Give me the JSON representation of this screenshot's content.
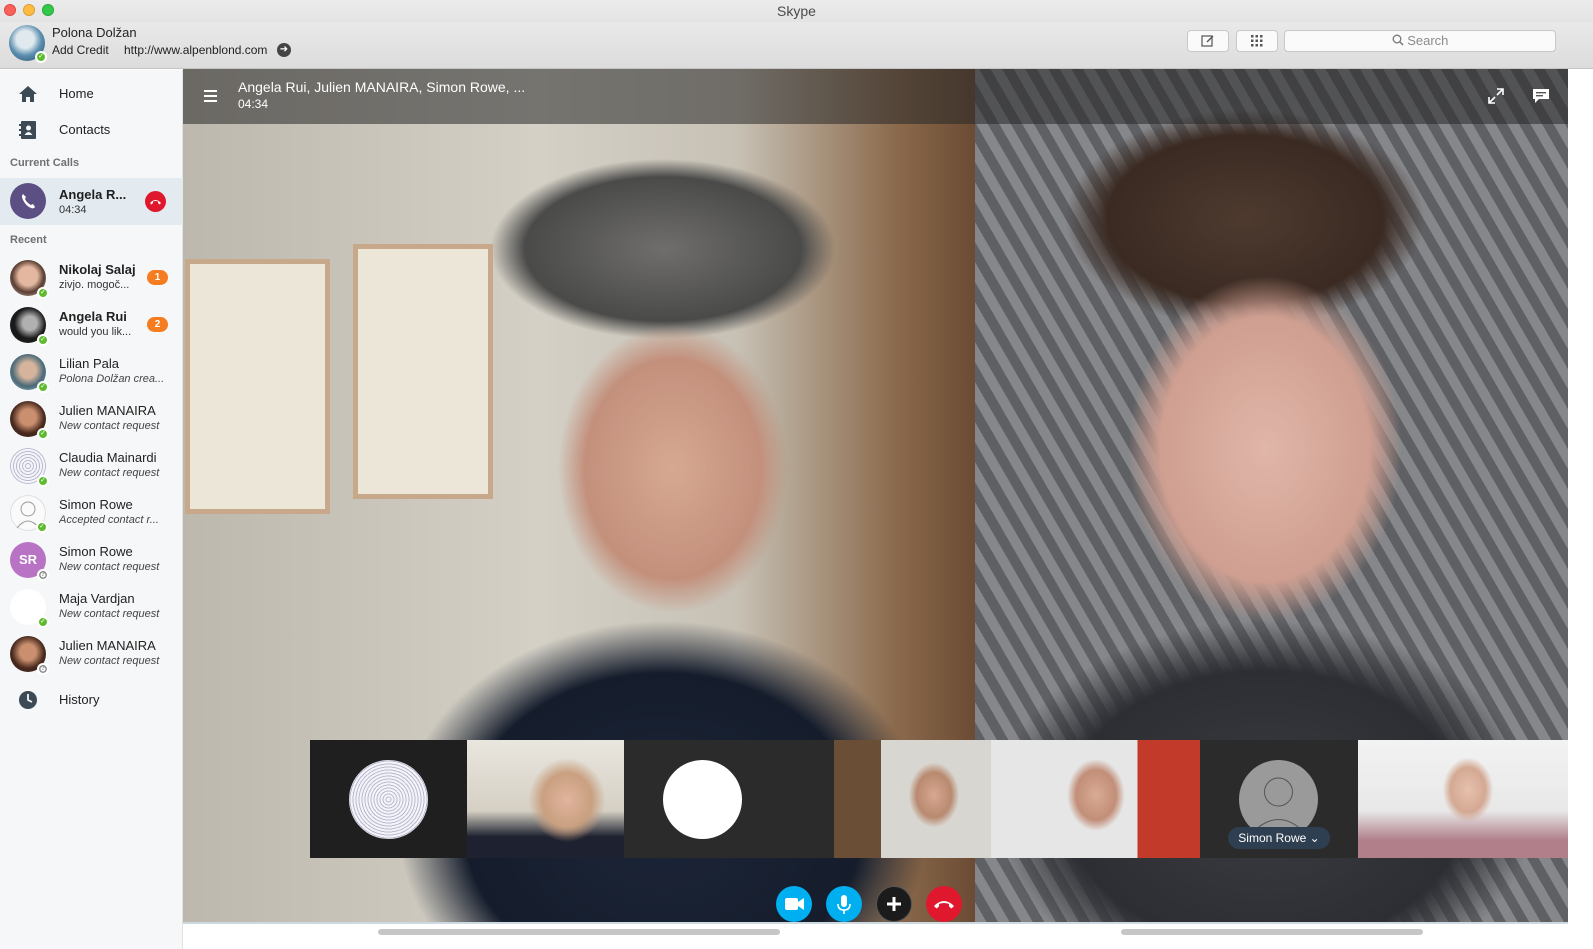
{
  "window": {
    "title": "Skype"
  },
  "profile": {
    "name": "Polona Dolžan",
    "add_credit": "Add Credit",
    "mood_link": "http://www.alpenblond.com"
  },
  "search": {
    "placeholder": "Search"
  },
  "sidebar": {
    "home_label": "Home",
    "contacts_label": "Contacts",
    "current_calls_title": "Current Calls",
    "current_call": {
      "name": "Angela R...",
      "duration": "04:34"
    },
    "recent_title": "Recent",
    "recent": [
      {
        "name": "Nikolaj Salaj",
        "status": "zivjo. mogoč...",
        "badge": "1",
        "bold": true
      },
      {
        "name": "Angela Rui",
        "status": "would you lik...",
        "badge": "2",
        "bold": true
      },
      {
        "name": "Lilian Pala",
        "status": "Polona Dolžan crea...",
        "badge": "",
        "bold": false
      },
      {
        "name": "Julien MANAIRA",
        "status": "New contact request",
        "badge": "",
        "bold": false
      },
      {
        "name": "Claudia Mainardi",
        "status": "New contact request",
        "badge": "",
        "bold": false
      },
      {
        "name": "Simon Rowe",
        "status": "Accepted contact r...",
        "badge": "",
        "bold": false
      },
      {
        "name": "Simon Rowe",
        "status": "New contact request",
        "badge": "",
        "bold": false,
        "initials": "SR"
      },
      {
        "name": "Maja Vardjan",
        "status": "New contact request",
        "badge": "",
        "bold": false
      },
      {
        "name": "Julien MANAIRA",
        "status": "New contact request",
        "badge": "",
        "bold": false
      }
    ],
    "history_label": "History"
  },
  "call": {
    "title": "Angela Rui, Julien MANAIRA, Simon Rowe, ...",
    "duration": "04:34",
    "thumbnail_name": "Simon Rowe"
  },
  "colors": {
    "accent": "#00aff0",
    "end_call": "#e0182d",
    "badge": "#f57c1f",
    "online": "#5fbb2e"
  }
}
